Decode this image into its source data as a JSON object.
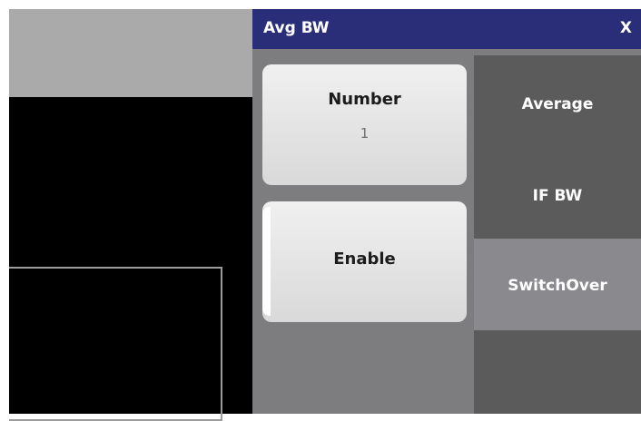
{
  "dialog": {
    "title": "Avg BW",
    "close_label": "X"
  },
  "softkeys": {
    "number": {
      "label": "Number",
      "value": "1"
    },
    "enable": {
      "label": "Enable"
    }
  },
  "tabs": [
    {
      "label": "Average"
    },
    {
      "label": "IF BW"
    },
    {
      "label": "SwitchOver"
    }
  ],
  "colors": {
    "titlebar": "#2a2e78",
    "dialog_bg": "#7d7d80",
    "tab_dark": "#5b5b5b",
    "tab_selected": "#8a8a8e",
    "softkey": "#e4e4e4"
  }
}
